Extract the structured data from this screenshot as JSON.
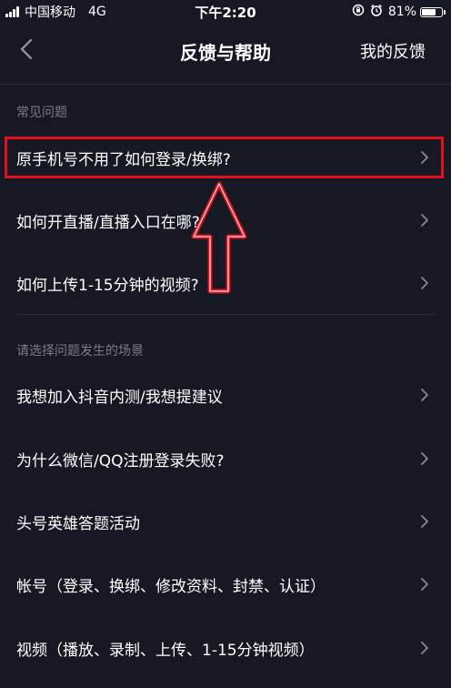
{
  "status_bar": {
    "carrier": "中国移动",
    "network": "4G",
    "time": "下午2:20",
    "battery_percent_text": "81%",
    "battery_level": 0.81,
    "icons": [
      "signal-icon",
      "screen-rotation-lock-icon",
      "alarm-icon",
      "battery-icon"
    ]
  },
  "nav": {
    "back_icon": "chevron-left-icon",
    "title": "反馈与帮助",
    "right_action": "我的反馈"
  },
  "sections": [
    {
      "header": "常见问题",
      "items": [
        {
          "label": "原手机号不用了如何登录/换绑?"
        },
        {
          "label": "如何开直播/直播入口在哪?"
        },
        {
          "label": "如何上传1-15分钟的视频?"
        }
      ]
    },
    {
      "header": "请选择问题发生的场景",
      "items": [
        {
          "label": "我想加入抖音内测/我想提建议"
        },
        {
          "label": "为什么微信/QQ注册登录失败?"
        },
        {
          "label": "头号英雄答题活动"
        },
        {
          "label": "帐号（登录、换绑、修改资料、封禁、认证）"
        },
        {
          "label": "视频（播放、录制、上传、1-15分钟视频）"
        }
      ]
    }
  ],
  "colors": {
    "background": "#161823",
    "text_primary": "#ffffff",
    "text_secondary": "#7c7d84",
    "chevron": "#8a8b91",
    "annotation_red": "#e0101c"
  }
}
